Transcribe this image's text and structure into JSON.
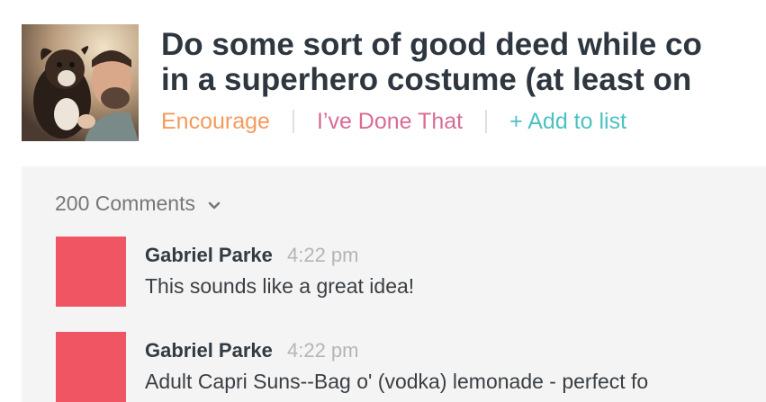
{
  "post": {
    "title_line1": "Do some sort of good deed while co",
    "title_line2": "in a superhero costume (at least on",
    "actions": {
      "encourage": "Encourage",
      "done": "I’ve Done That",
      "add": "+ Add to list"
    },
    "colors": {
      "encourage": "#f59a5d",
      "done": "#d96c94",
      "add": "#4cc1c4"
    }
  },
  "comments": {
    "count_label": "200 Comments",
    "items": [
      {
        "author": "Gabriel Parke",
        "time": "4:22 pm",
        "text": "This sounds like a great idea!",
        "avatar_color": "#f05563"
      },
      {
        "author": "Gabriel Parke",
        "time": "4:22 pm",
        "text": "Adult Capri Suns--Bag o' (vodka) lemonade - perfect fo",
        "avatar_color": "#f05563"
      }
    ]
  }
}
